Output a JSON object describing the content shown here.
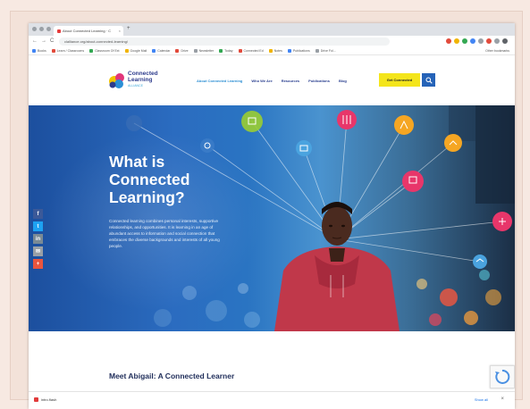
{
  "browser": {
    "tab_title": "About Connected Learning · C",
    "tab_close": "×",
    "new_tab": "+",
    "url": "clalliance.org/about-connected-learning/",
    "nav_back": "←",
    "nav_forward": "→",
    "nav_reload": "C",
    "bookmarks": [
      "Books",
      "Learn / Classrooms",
      "Classroom Of Ext",
      "Google Mail",
      "Calendar",
      "Drive",
      "Newsletter",
      "Today",
      "Connected Ed",
      "Notes",
      "Publications",
      "Drive Fol..."
    ],
    "bookmarks_right": "Other bookmarks",
    "colors": {
      "ext1": "#e24a3b",
      "ext2": "#f0b400",
      "ext3": "#34a853",
      "ext4": "#4285f4",
      "ext5": "#9aa0a6"
    }
  },
  "site": {
    "logo": {
      "line1": "Connected",
      "line2": "Learning",
      "sub": "ALLIANCE"
    },
    "nav": [
      "About Connected Learning",
      "Who We Are",
      "Resources",
      "Publications",
      "Blog"
    ],
    "get_connected": "Get Connected",
    "search_icon": "search-icon"
  },
  "hero": {
    "title_l1": "What is",
    "title_l2": "Connected",
    "title_l3": "Learning?",
    "body": "Connected learning combines personal interests, supportive relationships, and opportunities. It is learning in an age of abundant access to information and social connection that embraces the diverse backgrounds and interests of all young people.",
    "social": [
      "f",
      "t",
      "in",
      "✉",
      "+"
    ],
    "colors": {
      "facebook": "#3b5998",
      "twitter": "#1da1f2",
      "share": "#7a8a95",
      "email": "#9aa0a6",
      "plus": "#e8553e"
    }
  },
  "below": {
    "heading": "Meet Abigail: A Connected Learner"
  },
  "download": {
    "file": "intro.flash",
    "show_all": "Show all",
    "close": "×"
  }
}
